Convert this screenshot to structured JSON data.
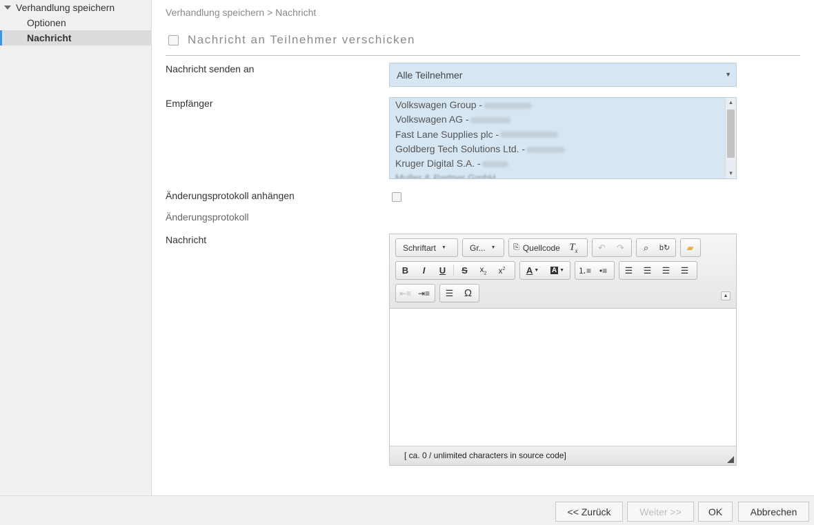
{
  "sidebar": {
    "root": "Verhandlung speichern",
    "items": [
      {
        "label": "Optionen",
        "active": false
      },
      {
        "label": "Nachricht",
        "active": true
      }
    ]
  },
  "breadcrumb": "Verhandlung speichern > Nachricht",
  "section": {
    "checkbox_title": "Nachricht an Teilnehmer verschicken",
    "checked": false
  },
  "form": {
    "send_to_label": "Nachricht senden an",
    "send_to_value": "Alle Teilnehmer",
    "recipients_label": "Empfänger",
    "recipients": [
      "Volkswagen Group -",
      "Volkswagen AG -",
      "Fast Lane Supplies plc -",
      "Goldberg Tech Solutions Ltd. -",
      "Kruger Digital S.A. -",
      "Muller & Partner GmbH"
    ],
    "changelog_attach_label": "Änderungsprotokoll anhängen",
    "changelog_attach_checked": false,
    "changelog_label": "Änderungsprotokoll",
    "message_label": "Nachricht"
  },
  "editor": {
    "font_combo": "Schriftart",
    "size_combo": "Gr...",
    "source_label": "Quellcode",
    "status": "[ ca. 0 / unlimited characters in source code]",
    "icons": [
      "document-source-icon",
      "remove-format-icon",
      "undo-icon",
      "redo-icon",
      "find-icon",
      "replace-icon",
      "open-folder-icon",
      "bold-icon",
      "italic-icon",
      "underline-icon",
      "strike-icon",
      "subscript-icon",
      "superscript-icon",
      "text-color-icon",
      "bg-color-icon",
      "numbered-list-icon",
      "bulleted-list-icon",
      "align-left-icon",
      "align-center-icon",
      "align-right-icon",
      "justify-icon",
      "outdent-icon",
      "indent-icon",
      "horizontal-line-icon",
      "special-char-icon"
    ]
  },
  "footer": {
    "back": "<< Zurück",
    "next": "Weiter >>",
    "ok": "OK",
    "cancel": "Abbrechen"
  }
}
